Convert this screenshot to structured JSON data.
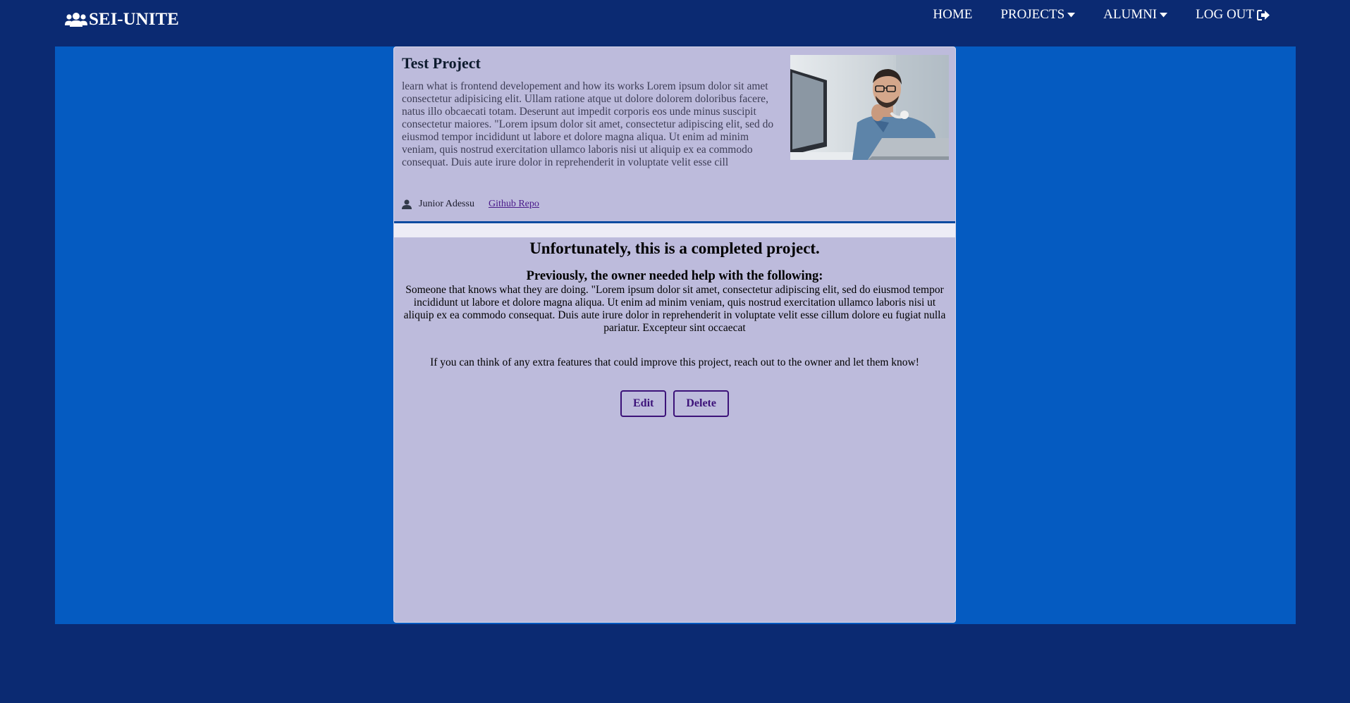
{
  "brand": {
    "name": "SEI-UNITE",
    "icon": "users-icon"
  },
  "nav": {
    "home": "HOME",
    "projects": "PROJECTS",
    "alumni": "ALUMNI",
    "logout": "LOG OUT"
  },
  "project": {
    "title": "Test Project",
    "description": "learn what is frontend developement and how its works Lorem ipsum dolor sit amet consectetur adipisicing elit. Ullam ratione atque ut dolore dolorem doloribus facere, natus illo obcaecati totam. Deserunt aut impedit corporis eos unde minus suscipit consectetur maiores. \"Lorem ipsum dolor sit amet, consectetur adipiscing elit, sed do eiusmod tempor incididunt ut labore et dolore magna aliqua. Ut enim ad minim veniam, quis nostrud exercitation ullamco laboris nisi ut aliquip ex ea commodo consequat. Duis aute irure dolor in reprehenderit in voluptate velit esse cill",
    "owner": "Junior Adessu",
    "repo_link": "Github Repo",
    "image": "man-at-computer-photo"
  },
  "status": {
    "heading": "Unfortunately, this is a completed project.",
    "needs_heading": "Previously, the owner needed help with the following:",
    "needs_text": "Someone that knows what they are doing. \"Lorem ipsum dolor sit amet, consectetur adipiscing elit, sed do eiusmod tempor incididunt ut labore et dolore magna aliqua. Ut enim ad minim veniam, quis nostrud exercitation ullamco laboris nisi ut aliquip ex ea commodo consequat. Duis aute irure dolor in reprehenderit in voluptate velit esse cillum dolore eu fugiat nulla pariatur. Excepteur sint occaecat",
    "extra_text": "If you can think of any extra features that could improve this project, reach out to the owner and let them know!"
  },
  "actions": {
    "edit": "Edit",
    "delete": "Delete"
  },
  "colors": {
    "page_bg": "#0b2a72",
    "main_bg": "#055bc1",
    "card_bg": "#bdbbdc",
    "accent": "#3c1279",
    "divider": "#0b4aa0"
  }
}
